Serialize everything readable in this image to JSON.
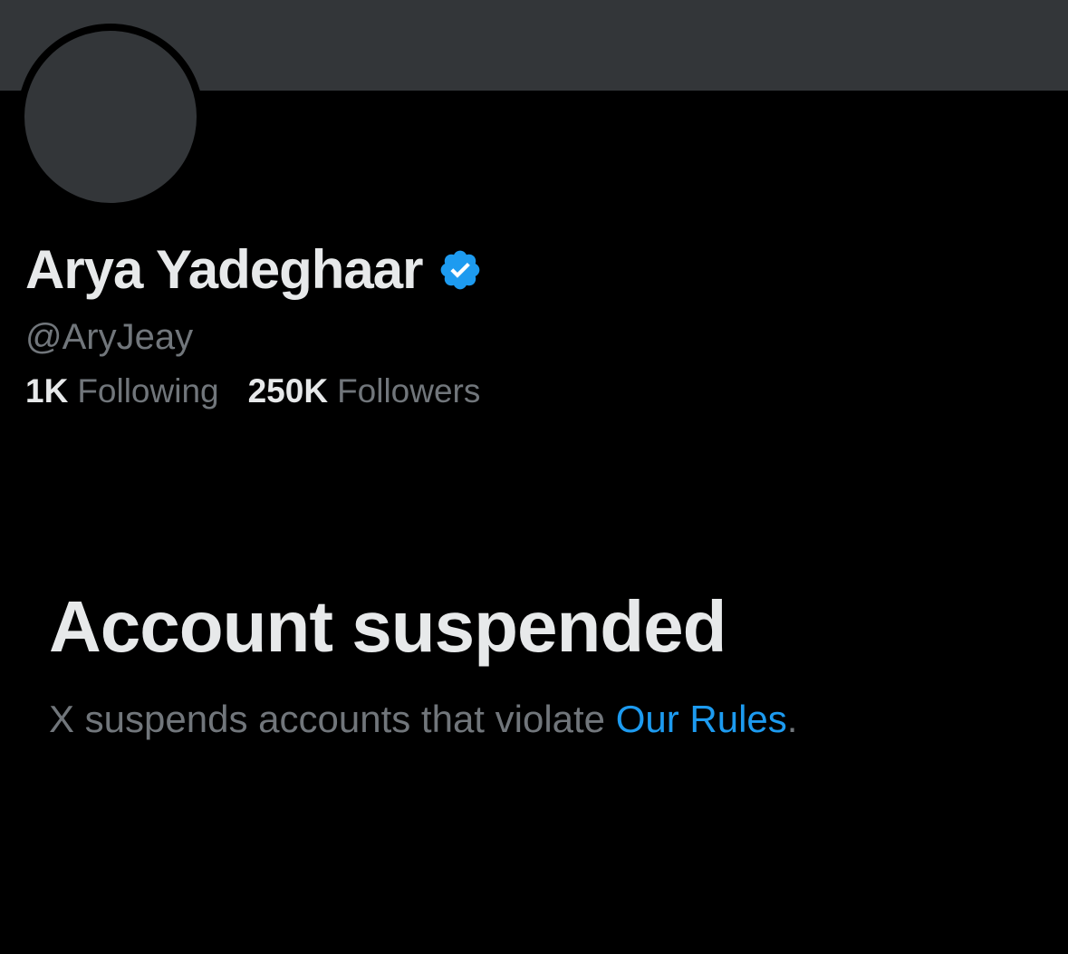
{
  "profile": {
    "display_name": "Arya Yadeghaar",
    "handle": "@AryJeay",
    "verified": true,
    "badge_icon": "verified-badge-icon",
    "stats": {
      "following_count": "1K",
      "following_label": "Following",
      "followers_count": "250K",
      "followers_label": "Followers"
    }
  },
  "suspension": {
    "title": "Account suspended",
    "message_prefix": "X suspends accounts that violate ",
    "rules_link": "Our Rules",
    "message_suffix": "."
  },
  "colors": {
    "background": "#000000",
    "banner": "#333639",
    "primary_text": "#e7e9ea",
    "secondary_text": "#71767b",
    "accent": "#1d9bf0"
  }
}
